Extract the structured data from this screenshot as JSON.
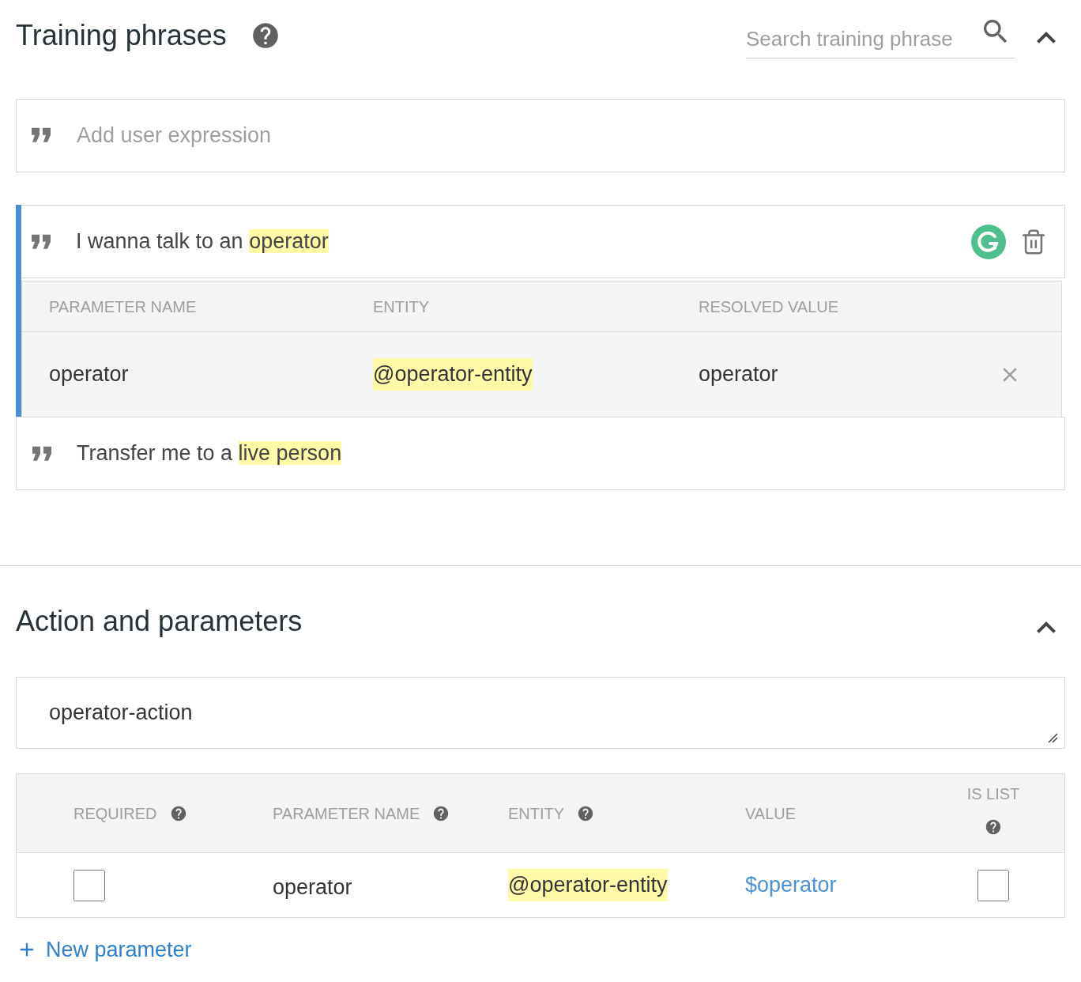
{
  "training": {
    "title": "Training phrases",
    "search": {
      "placeholder": "Search training phrase"
    },
    "add": {
      "placeholder": "Add user expression"
    },
    "phrases": [
      {
        "selected": true,
        "segments": [
          {
            "text": "I wanna talk to an ",
            "highlight": false
          },
          {
            "text": "operator",
            "highlight": true
          }
        ],
        "params": {
          "columns": [
            "PARAMETER NAME",
            "ENTITY",
            "RESOLVED VALUE"
          ],
          "rows": [
            {
              "name": "operator",
              "entity": "@operator-entity",
              "resolved": "operator"
            }
          ]
        }
      },
      {
        "selected": false,
        "segments": [
          {
            "text": "Transfer me to a ",
            "highlight": false
          },
          {
            "text": "live person",
            "highlight": true
          }
        ]
      }
    ]
  },
  "action": {
    "title": "Action and parameters",
    "value": "operator-action",
    "columns": [
      {
        "label": "REQUIRED",
        "help": true
      },
      {
        "label": "PARAMETER NAME",
        "help": true
      },
      {
        "label": "ENTITY",
        "help": true
      },
      {
        "label": "VALUE",
        "help": false
      },
      {
        "label": "IS LIST",
        "help": true
      }
    ],
    "rows": [
      {
        "required": false,
        "name": "operator",
        "entity": "@operator-entity",
        "value": "$operator",
        "is_list": false
      }
    ],
    "new_button": "New parameter"
  }
}
